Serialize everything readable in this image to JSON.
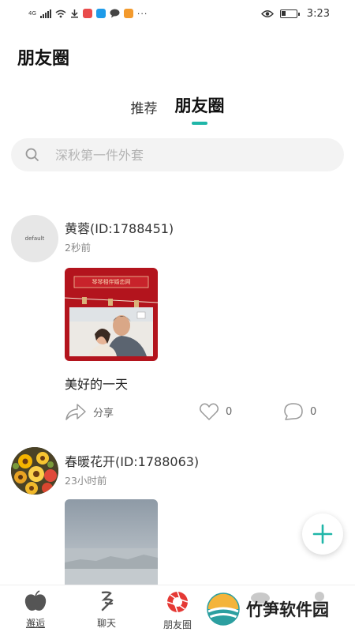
{
  "status_bar": {
    "network": "4G",
    "time": "3:23"
  },
  "header": {
    "title": "朋友圈"
  },
  "tabs": [
    {
      "label": "推荐",
      "active": false
    },
    {
      "label": "朋友圈",
      "active": true
    }
  ],
  "search": {
    "placeholder": "深秋第一件外套",
    "value": ""
  },
  "posts": [
    {
      "avatar_text": "default",
      "name": "黄蓉(ID:1788451)",
      "time": "2秒前",
      "image_caption": "琴琴相伴婚恋网",
      "text": "美好的一天",
      "share_label": "分享",
      "likes": "0",
      "comments": "0"
    },
    {
      "name": "春暖花开(ID:1788063)",
      "time": "23小时前"
    }
  ],
  "bottom_nav": [
    {
      "label": "邂逅",
      "icon": "apple-icon"
    },
    {
      "label": "聊天",
      "icon": "chat-brush-icon"
    },
    {
      "label": "朋友圈",
      "icon": "camera-aperture-icon"
    }
  ],
  "watermark": {
    "text": "竹笋软件园"
  },
  "colors": {
    "accent": "#1fb6a8",
    "nav_active": "#e53935"
  }
}
